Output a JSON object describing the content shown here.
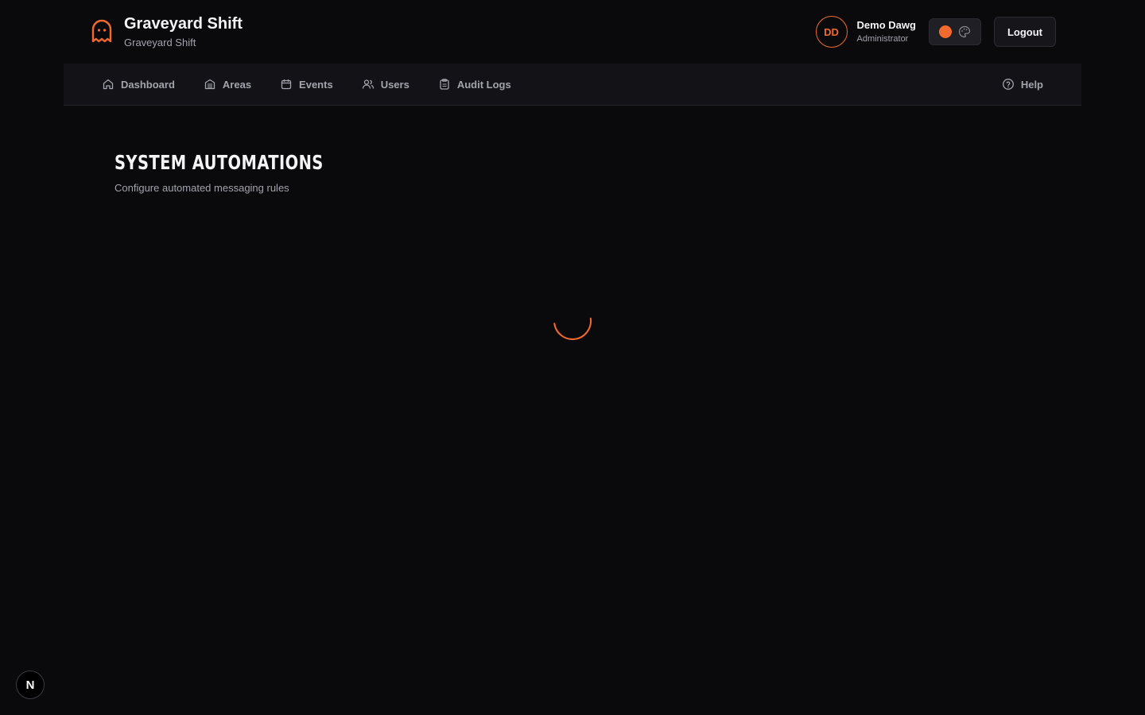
{
  "brand": {
    "title": "Graveyard Shift",
    "subtitle": "Graveyard Shift"
  },
  "user": {
    "initials": "DD",
    "name": "Demo Dawg",
    "role": "Administrator"
  },
  "header": {
    "logout_label": "Logout"
  },
  "nav": {
    "items": [
      {
        "label": "Dashboard",
        "icon": "home-icon"
      },
      {
        "label": "Areas",
        "icon": "building-icon"
      },
      {
        "label": "Events",
        "icon": "calendar-icon"
      },
      {
        "label": "Users",
        "icon": "users-icon"
      },
      {
        "label": "Audit Logs",
        "icon": "clipboard-icon"
      }
    ],
    "help_label": "Help"
  },
  "page": {
    "title": "SYSTEM AUTOMATIONS",
    "description": "Configure automated messaging rules"
  },
  "dev_badge": {
    "label": "N"
  },
  "colors": {
    "accent": "#f26a2e",
    "background": "#0a0a0c",
    "nav_background": "#131317"
  }
}
